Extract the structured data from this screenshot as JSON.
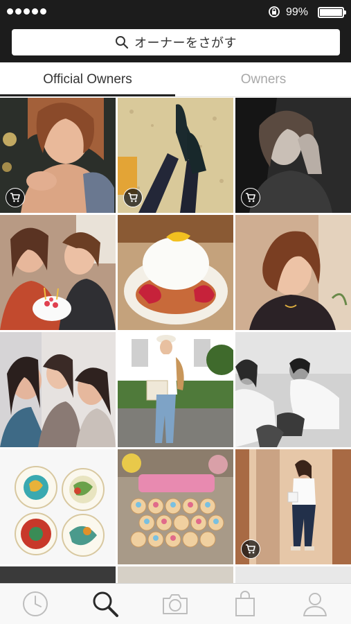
{
  "status_bar": {
    "battery_percent": "99%"
  },
  "search": {
    "placeholder": "オーナーをさがす"
  },
  "tabs": [
    {
      "label": "Official Owners",
      "active": true
    },
    {
      "label": "Owners",
      "active": false
    }
  ],
  "grid": {
    "tiles": [
      {
        "row": 1,
        "col": 1,
        "subject": "woman-portrait-warm",
        "cart_badge": true
      },
      {
        "row": 1,
        "col": 2,
        "subject": "legs-boots-gravel",
        "cart_badge": true
      },
      {
        "row": 1,
        "col": 3,
        "subject": "woman-portrait-bw",
        "cart_badge": true
      },
      {
        "row": 2,
        "col": 1,
        "subject": "friends-with-cake",
        "cart_badge": false
      },
      {
        "row": 2,
        "col": 2,
        "subject": "strawberry-dessert",
        "cart_badge": false
      },
      {
        "row": 2,
        "col": 3,
        "subject": "woman-smiling",
        "cart_badge": false
      },
      {
        "row": 3,
        "col": 1,
        "subject": "group-selfie",
        "cart_badge": false
      },
      {
        "row": 3,
        "col": 2,
        "subject": "woman-outdoors-hat",
        "cart_badge": false
      },
      {
        "row": 3,
        "col": 3,
        "subject": "fitting-bw",
        "cart_badge": false
      },
      {
        "row": 4,
        "col": 1,
        "subject": "painted-plates",
        "cart_badge": false
      },
      {
        "row": 4,
        "col": 2,
        "subject": "cupcakes",
        "cart_badge": false
      },
      {
        "row": 4,
        "col": 3,
        "subject": "mirror-selfie",
        "cart_badge": true
      }
    ]
  },
  "tab_bar": {
    "items": [
      {
        "icon": "clock-icon",
        "selected": false
      },
      {
        "icon": "search-icon",
        "selected": true
      },
      {
        "icon": "camera-icon",
        "selected": false
      },
      {
        "icon": "bag-icon",
        "selected": false
      },
      {
        "icon": "person-icon",
        "selected": false
      }
    ]
  },
  "colors": {
    "header_bg": "#1c1c1c",
    "active_tab_text": "#333333",
    "inactive_tab_text": "#a8a8a8",
    "tabbar_icon_inactive": "#bdbdbd",
    "tabbar_icon_active": "#2a2a2a"
  }
}
